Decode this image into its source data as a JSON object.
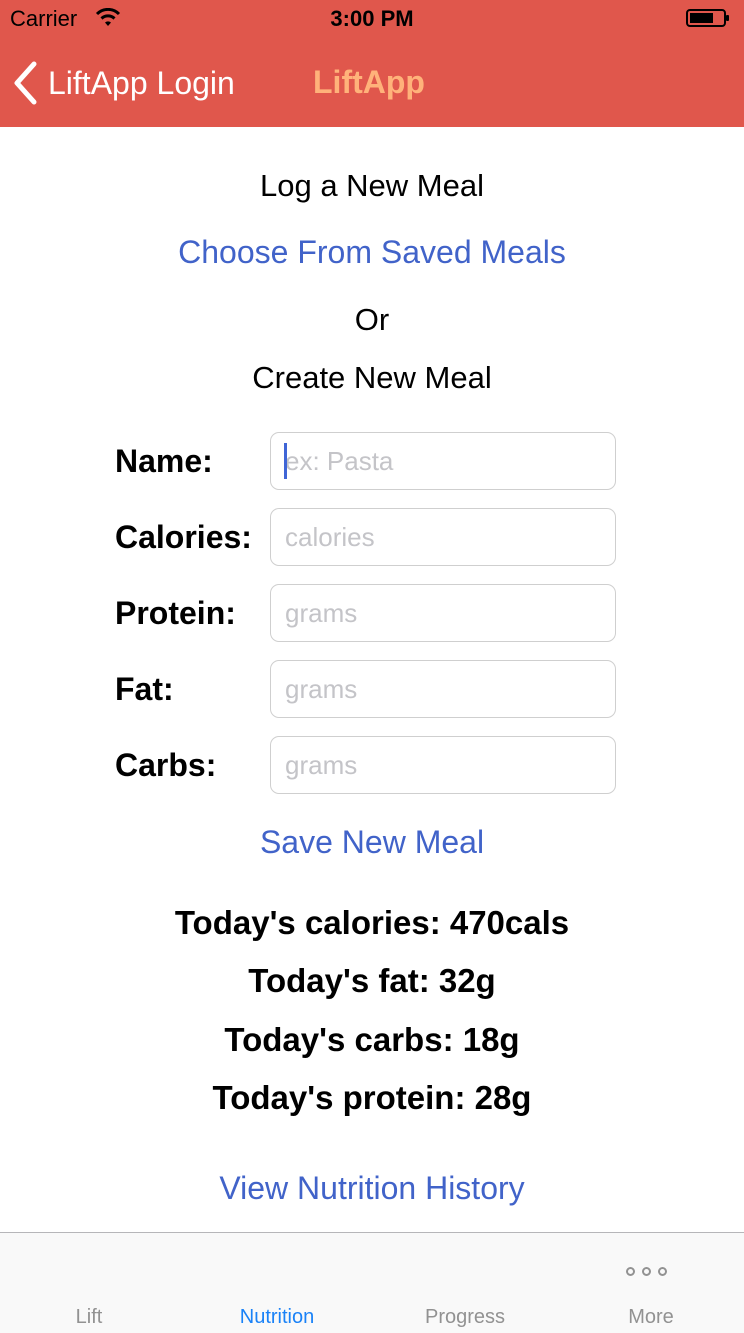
{
  "status_bar": {
    "carrier": "Carrier",
    "time": "3:00 PM"
  },
  "nav": {
    "back_label": "LiftApp Login",
    "title": "LiftApp"
  },
  "main": {
    "heading": "Log a New Meal",
    "choose_saved_link": "Choose From Saved Meals",
    "or_text": "Or",
    "create_heading": "Create New Meal",
    "save_button": "Save New Meal",
    "history_link": "View Nutrition History"
  },
  "form": {
    "name": {
      "label": "Name:",
      "placeholder": "ex: Pasta",
      "value": ""
    },
    "calories": {
      "label": "Calories:",
      "placeholder": "calories",
      "value": ""
    },
    "protein": {
      "label": "Protein:",
      "placeholder": "grams",
      "value": ""
    },
    "fat": {
      "label": "Fat:",
      "placeholder": "grams",
      "value": ""
    },
    "carbs": {
      "label": "Carbs:",
      "placeholder": "grams",
      "value": ""
    }
  },
  "summary": {
    "calories": "Today's calories: 470cals",
    "fat": "Today's fat: 32g",
    "carbs": "Today's carbs: 18g",
    "protein": "Today's protein: 28g"
  },
  "tabs": [
    {
      "label": "Lift",
      "active": false
    },
    {
      "label": "Nutrition",
      "active": true
    },
    {
      "label": "Progress",
      "active": false
    },
    {
      "label": "More",
      "active": false,
      "icon": "more-icon"
    }
  ],
  "colors": {
    "header": "#e0574c",
    "title_accent": "#ffb27a",
    "link": "#4163c9",
    "tab_active": "#1a82f7",
    "tab_inactive": "#929292"
  }
}
